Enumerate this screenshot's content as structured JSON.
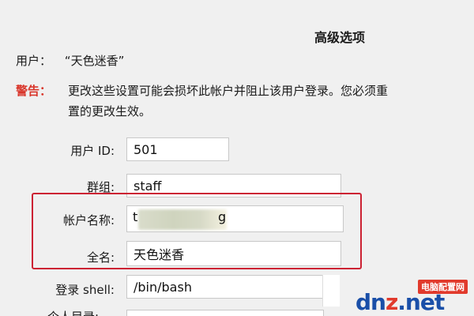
{
  "panel": {
    "title": "高级选项"
  },
  "user": {
    "label": "用户：",
    "name": "“天色迷香”"
  },
  "warning": {
    "label": "警告：",
    "line1": "更改这些设置可能会损坏此帐户并阻止该用户登录。您必须重",
    "line2": "置的更改生效。"
  },
  "form": {
    "user_id": {
      "label": "用户 ID:",
      "value": "501"
    },
    "group": {
      "label": "群组:",
      "value": "staff"
    },
    "account_name": {
      "label": "帐户名称:",
      "prefix": "t",
      "suffix": "g"
    },
    "full_name": {
      "label": "全名:",
      "value": "天色迷香"
    },
    "login_shell": {
      "label": "登录 shell:",
      "value": "/bin/bash"
    },
    "home_dir": {
      "label": "个人目录:"
    }
  },
  "watermark": {
    "cn": "电脑配置网",
    "logo_prefix": "dn",
    "logo_z": "z",
    "logo_suffix": ".net"
  },
  "colors": {
    "highlight": "#cc2233",
    "warning": "#d9362b",
    "watermark_blue": "#1a4fa8",
    "watermark_red": "#e13a2c"
  }
}
